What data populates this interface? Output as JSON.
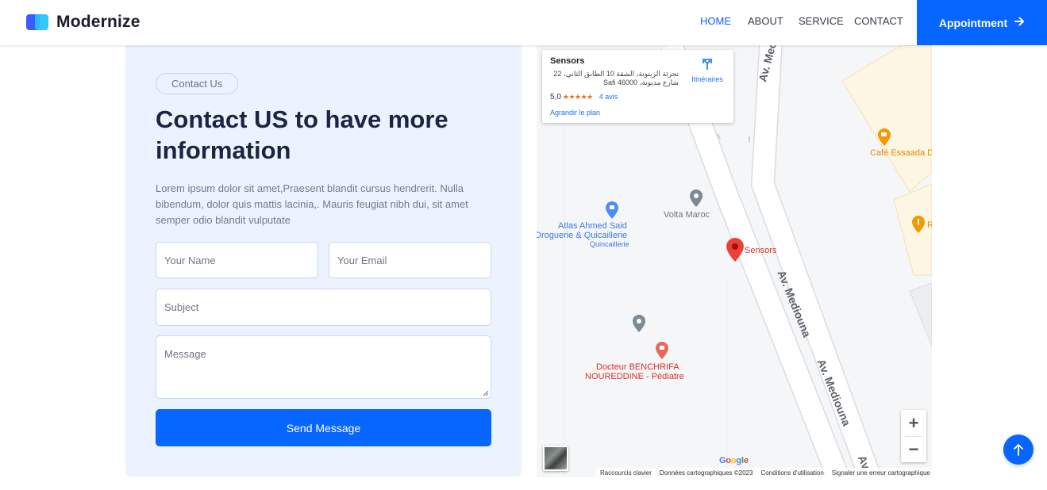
{
  "header": {
    "brand": "Modernize",
    "nav": [
      {
        "label": "HOME",
        "active": true
      },
      {
        "label": "ABOUT",
        "active": false
      },
      {
        "label": "SERVICE",
        "active": false
      },
      {
        "label": "CONTACT",
        "active": false
      }
    ],
    "cta_label": "Appointment",
    "cta_icon": "arrow-right-icon"
  },
  "contact": {
    "badge": "Contact Us",
    "title": "Contact US to have more information",
    "description": "Lorem ipsum dolor sit amet,Praesent blandit cursus hendrerit. Nulla bibendum, dolor quis mattis lacinia,. Mauris feugiat nibh dui, sit amet semper odio blandit vulputate",
    "fields": {
      "name_placeholder": "Your Name",
      "email_placeholder": "Your Email",
      "subject_placeholder": "Subject",
      "message_placeholder": "Message"
    },
    "submit_label": "Send Message"
  },
  "map": {
    "card": {
      "place_name": "Sensors",
      "address": "تجزئة الزيتونة، الشقة 10 الطابق الثاني، 22 شارع مديونة، Safi 46000",
      "rating": "5,0",
      "stars": "★★★★★",
      "reviews": "4 avis",
      "directions": "Itinéraires",
      "enlarge": "Agrandir le plan"
    },
    "labels": {
      "street_top": "Av. Mec",
      "street_mid": "Av. Mediouna",
      "street_low": "Av. Mediouna",
      "street_bottom": "Av",
      "cafe": "Café Essaada D",
      "resto": "R",
      "volta": "Volta Maroc",
      "atlas_1": "Atlas Ahmed Said",
      "atlas_2": "Droguerie & Quicaillerie",
      "atlas_3": "Quincaillerie",
      "sensors": "Sensors",
      "doctor_1": "Docteur BENCHRIFA",
      "doctor_2": "NOUREDDINE - Pédiatre"
    },
    "zoom_in": "+",
    "zoom_out": "−",
    "google": "Google",
    "footer": {
      "shortcuts": "Raccourcis clavier",
      "data": "Données cartographiques ©2023",
      "terms": "Conditions d'utilisation",
      "report": "Signaler une erreur cartographique"
    }
  },
  "scroll_top_icon": "arrow-up-icon",
  "colors": {
    "primary": "#0766ff",
    "panel_bg": "#ecf3fe",
    "title": "#1b2442",
    "map_pin": "#ea4335"
  }
}
